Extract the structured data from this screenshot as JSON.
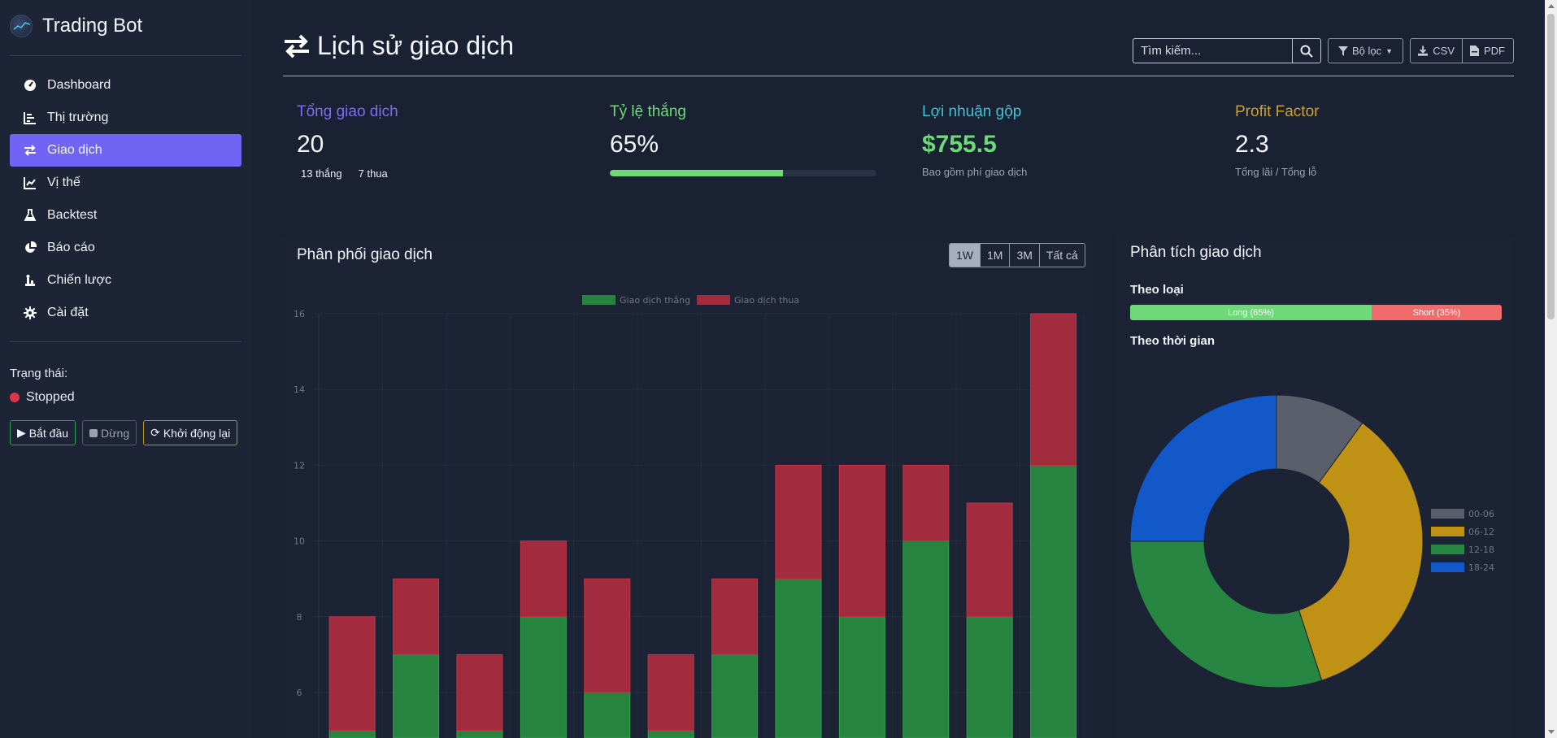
{
  "app": {
    "title": "Trading Bot"
  },
  "sidebar": {
    "items": [
      {
        "label": "Dashboard",
        "icon": "gauge-icon"
      },
      {
        "label": "Thị trường",
        "icon": "list-chart-icon"
      },
      {
        "label": "Giao dịch",
        "icon": "exchange-icon",
        "active": true
      },
      {
        "label": "Vị thế",
        "icon": "line-chart-icon"
      },
      {
        "label": "Backtest",
        "icon": "flask-icon"
      },
      {
        "label": "Báo cáo",
        "icon": "pie-chart-icon"
      },
      {
        "label": "Chiến lược",
        "icon": "chess-icon"
      },
      {
        "label": "Cài đặt",
        "icon": "gear-icon"
      }
    ],
    "status_label": "Trạng thái:",
    "status_value": "Stopped",
    "status_color": "#e0344a",
    "buttons": {
      "start": "Bắt đầu",
      "stop": "Dừng",
      "restart": "Khởi động lại"
    }
  },
  "header": {
    "title": "Lịch sử giao dịch",
    "search_placeholder": "Tìm kiếm...",
    "filter_label": "Bộ lọc",
    "csv_label": "CSV",
    "pdf_label": "PDF"
  },
  "stats": {
    "total": {
      "label": "Tổng giao dịch",
      "value": "20",
      "wins": "13 thắng",
      "losses": "7 thua",
      "color": "#7c6cf6"
    },
    "win_rate": {
      "label": "Tỷ lệ thắng",
      "value": "65%",
      "progress": 0.65,
      "color": "#6fd97a"
    },
    "gross_profit": {
      "label": "Lợi nhuận gộp",
      "value": "$755.5",
      "sub": "Bao gồm phí giao dịch",
      "color": "#3cc3d6",
      "value_color": "#6fd97a"
    },
    "profit_factor": {
      "label": "Profit Factor",
      "value": "2.3",
      "sub": "Tổng lãi / Tổng lỗ",
      "color": "#c9a227"
    }
  },
  "distribution": {
    "title": "Phân phối giao dịch",
    "ranges": [
      "1W",
      "1M",
      "3M",
      "Tất cả"
    ],
    "active_range": "1W"
  },
  "analysis": {
    "title": "Phân tích giao dịch",
    "by_type_title": "Theo loại",
    "long_label": "Long (65%)",
    "short_label": "Short (35%)",
    "long_share": 0.65,
    "by_time_title": "Theo thời gian"
  },
  "chart_data": [
    {
      "type": "bar",
      "stacked": true,
      "legend_position": "top",
      "categories": [
        "",
        "",
        "",
        "",
        "",
        "",
        "",
        "",
        "",
        "",
        "",
        ""
      ],
      "series": [
        {
          "name": "Giao dịch thắng",
          "color": "#27843f",
          "values": [
            5,
            7,
            5,
            8,
            6,
            5,
            7,
            9,
            8,
            10,
            8,
            12
          ]
        },
        {
          "name": "Giao dịch thua",
          "color": "#a22c3e",
          "values": [
            3,
            2,
            2,
            2,
            3,
            2,
            2,
            3,
            4,
            2,
            3,
            4
          ]
        }
      ],
      "y_ticks": [
        6,
        8,
        10,
        12,
        14,
        16
      ],
      "ylim_visible": [
        5.2,
        16.2
      ],
      "grid": true
    },
    {
      "type": "pie",
      "donut": true,
      "legend_position": "right",
      "labels": [
        "00-06",
        "06-12",
        "12-18",
        "18-24"
      ],
      "values": [
        10,
        35,
        30,
        25
      ],
      "colors": [
        "#5a606b",
        "#bf9115",
        "#278641",
        "#1258c8"
      ]
    }
  ]
}
